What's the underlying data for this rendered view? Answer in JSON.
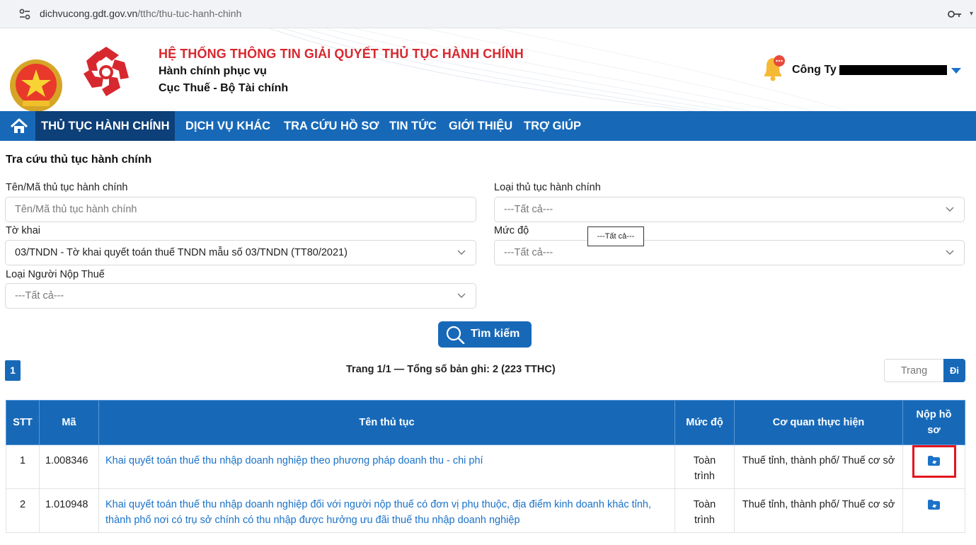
{
  "browser": {
    "url_host": "dichvucong.gdt.gov.vn",
    "url_path": "/tthc/thu-tuc-hanh-chinh"
  },
  "header": {
    "system_title": "HỆ THỐNG THÔNG TIN GIẢI QUYẾT THỦ TỤC HÀNH CHÍNH",
    "subtitle_1": "Hành chính phục vụ",
    "subtitle_2": "Cục Thuế - Bộ Tài chính",
    "company_prefix": "Công Ty",
    "icons": [
      "national-emblem",
      "logo",
      "notification-bell-icon",
      "chevron-down-icon"
    ]
  },
  "nav": {
    "items": [
      {
        "label": "THỦ TỤC HÀNH CHÍNH",
        "active": true
      },
      {
        "label": "DỊCH VỤ KHÁC"
      },
      {
        "label": "TRA CỨU HỒ SƠ"
      },
      {
        "label": "TIN TỨC"
      },
      {
        "label": "GIỚI THIỆU"
      },
      {
        "label": "TRỢ GIÚP"
      }
    ]
  },
  "search": {
    "page_title": "Tra cứu thủ tục hành chính",
    "name_label": "Tên/Mã thủ tục hành chính",
    "name_placeholder": "Tên/Mã thủ tục hành chính",
    "type_label": "Loại thủ tục hành chính",
    "type_value": "---Tất cả---",
    "form_label": "Tờ khai",
    "form_value": "03/TNDN - Tờ khai quyết toán thuế TNDN mẫu số 03/TNDN (TT80/2021)",
    "level_label": "Mức độ",
    "level_value": "---Tất cả---",
    "level_tooltip": "---Tất cả---",
    "taxpayer_label": "Loại Người Nộp Thuế",
    "taxpayer_value": "---Tất cả---",
    "button_label": "Tìm kiếm"
  },
  "pagination": {
    "current_page": "1",
    "info": "Trang 1/1 — Tổng số bản ghi: 2 (223 TTHC)",
    "goto_placeholder": "Trang",
    "go_label": "Đi"
  },
  "table": {
    "headers": {
      "stt": "STT",
      "code": "Mã",
      "name": "Tên thủ tục",
      "level": "Mức độ",
      "agency": "Cơ quan thực hiện",
      "submit": "Nộp hồ sơ"
    },
    "rows": [
      {
        "stt": "1",
        "code": "1.008346",
        "name": "Khai quyết toán thuế thu nhập doanh nghiệp theo phương pháp doanh thu - chi phí",
        "level": "Toàn trình",
        "agency": "Thuế tỉnh, thành phố/ Thuế cơ sở",
        "submit_icon": "folder-upload-icon"
      },
      {
        "stt": "2",
        "code": "1.010948",
        "name": "Khai quyết toán thuế thu nhập doanh nghiệp đối với người nộp thuế có đơn vị phụ thuộc, địa điểm kinh doanh khác tỉnh, thành phố nơi có trụ sở chính có thu nhập được hưởng ưu đãi thuế thu nhập doanh nghiệp",
        "level": "Toàn trình",
        "agency": "Thuế tỉnh, thành phố/ Thuế cơ sở",
        "submit_icon": "folder-upload-icon"
      }
    ]
  },
  "colors": {
    "primary": "#1769b8",
    "nav_active": "#0d3f78",
    "title_red": "#d7282f",
    "link": "#1a72c9",
    "highlight": "#e3161e"
  }
}
